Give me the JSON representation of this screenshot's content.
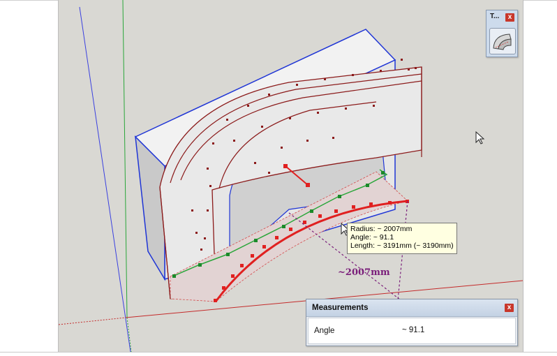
{
  "tool_palette": {
    "title": "T...",
    "close_glyph": "x",
    "tool_icon": "arc-tool-icon"
  },
  "tooltip": {
    "radius": "Radius: ~ 2007mm",
    "angle": "Angle: ~ 91.1",
    "length": "Length: ~ 3191mm (~ 3190mm)"
  },
  "dimension_label": "~2007mm",
  "measurements": {
    "title": "Measurements",
    "close_glyph": "x",
    "label": "Angle",
    "value": "~ 91.1"
  },
  "colors": {
    "viewport_bg": "#d9d8d3",
    "edge_red": "#8b1a1a",
    "edge_blue": "#1f35d6",
    "axis_green": "#2aa63a",
    "dimension_purple": "#7a1e7a"
  }
}
